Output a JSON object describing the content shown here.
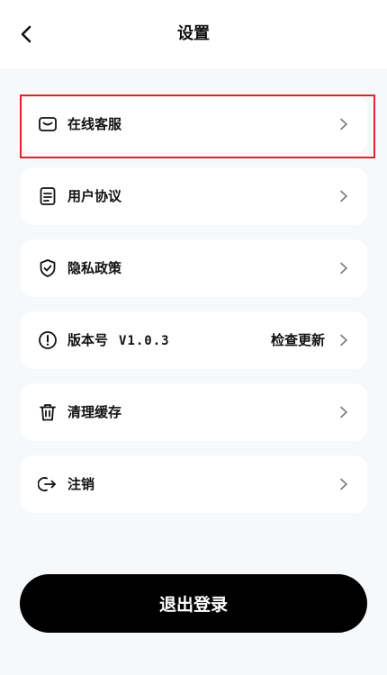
{
  "header": {
    "title": "设置",
    "back_icon": "chevron-left-icon"
  },
  "menu": {
    "items": [
      {
        "label": "在线客服",
        "icon": "message-icon"
      },
      {
        "label": "用户协议",
        "icon": "document-icon"
      },
      {
        "label": "隐私政策",
        "icon": "shield-check-icon"
      },
      {
        "label": "版本号",
        "version": "V1.0.3",
        "right_text": "检查更新",
        "icon": "info-icon"
      },
      {
        "label": "清理缓存",
        "icon": "trash-icon"
      },
      {
        "label": "注销",
        "icon": "logout-icon"
      }
    ]
  },
  "logout": {
    "label": "退出登录"
  },
  "colors": {
    "background": "#f7f8fa",
    "card": "#ffffff",
    "highlight": "#e0242b",
    "logout_button": "#000000"
  }
}
